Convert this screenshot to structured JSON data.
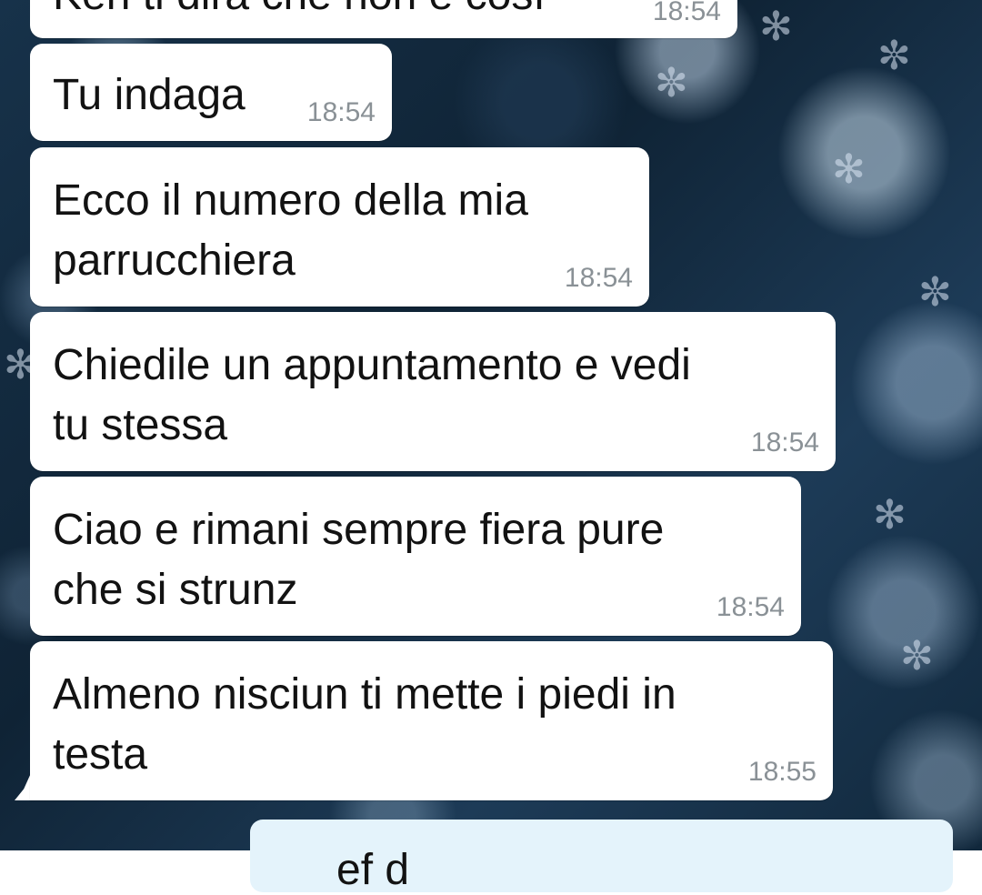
{
  "chat": {
    "messages": [
      {
        "text": "Keh ti dirà che non è così",
        "time": "18:54"
      },
      {
        "text": "Tu indaga",
        "time": "18:54"
      },
      {
        "line1": "Ecco il numero della mia",
        "line2": "parrucchiera",
        "time": "18:54"
      },
      {
        "line1": "Chiedile un appuntamento e vedi",
        "line2": "tu stessa",
        "time": "18:54"
      },
      {
        "line1": "Ciao e rimani sempre fiera pure",
        "line2": "che si strunz",
        "time": "18:54"
      },
      {
        "line1": "Almeno nisciun ti mette i piedi in",
        "line2": "testa",
        "time": "18:55"
      }
    ],
    "outgoing_partial": "ef d"
  }
}
